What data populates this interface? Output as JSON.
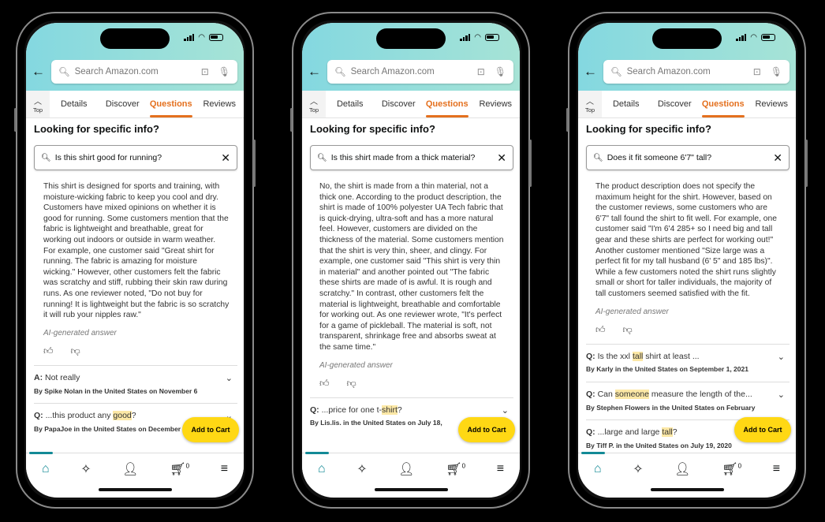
{
  "common": {
    "search_placeholder": "Search Amazon.com",
    "top_label": "Top",
    "tabs": [
      "Details",
      "Discover",
      "Questions",
      "Reviews"
    ],
    "active_tab": "Questions",
    "section_title": "Looking for specific info?",
    "ai_label": "AI-generated answer",
    "add_to_cart": "Add to Cart",
    "cart_count": "0",
    "accent": "#e4701e",
    "nav_icons": [
      "home-icon",
      "sparkle-icon",
      "profile-icon",
      "cart-icon",
      "menu-icon"
    ]
  },
  "phones": [
    {
      "query": "Is this shirt good for running?",
      "answer": "This shirt is designed for sports and training, with moisture-wicking fabric to keep you cool and dry. Customers have mixed opinions on whether it is good for running. Some customers mention that the fabric is lightweight and breathable, great for working out indoors or outside in warm weather. For example, one customer said \"Great shirt for running. The fabric is amazing for moisture wicking.\" However, other customers felt the fabric was scratchy and stiff, rubbing their skin raw during runs. As one reviewer noted, \"Do not buy for running! It is lightweight but the fabric is so scratchy it will rub your nipples raw.\"",
      "items": [
        {
          "label": "A:",
          "pre": " Not really",
          "hl": "",
          "post": "",
          "by": "By Spike Nolan in the United States on November 6"
        },
        {
          "label": "Q:",
          "pre": " ...this product any ",
          "hl": "good",
          "post": "?",
          "by": "By PapaJoe in the United States on December"
        }
      ]
    },
    {
      "query": "Is this shirt made from a thick material?",
      "answer": "No, the shirt is made from a thin material, not a thick one. According to the product description, the shirt is made of 100% polyester UA Tech fabric that is quick-drying, ultra-soft and has a more natural feel. However, customers are divided on the thickness of the material. Some customers mention that the shirt is very thin, sheer, and clingy. For example, one customer said \"This shirt is very thin in material\" and another pointed out \"The fabric these shirts are made of is awful. It is rough and scratchy.\" In contrast, other customers felt the material is lightweight, breathable and comfortable for working out. As one reviewer wrote, \"It's perfect for a game of pickleball. The material is soft, not transparent, shrinkage free and absorbs sweat at the same time.\"",
      "items": [
        {
          "label": "Q:",
          "pre": " ...price for one t-",
          "hl": "shirt",
          "post": "?",
          "by": "By Lis.lis. in the United States on July 18,"
        }
      ]
    },
    {
      "query": "Does it fit someone 6'7\" tall?",
      "answer": "The product description does not specify the maximum height for the shirt. However, based on the customer reviews, some customers who are 6'7\" tall found the shirt to fit well. For example, one customer said \"I'm 6'4 285+ so I need big and tall gear and these shirts are perfect for working out!\" Another customer mentioned \"Size large was a perfect fit for my tall husband (6' 5\" and 185 lbs)\". While a few customers noted the shirt runs slightly small or short for taller individuals, the majority of tall customers seemed satisfied with the fit.",
      "items": [
        {
          "label": "Q:",
          "pre": " Is the xxl ",
          "hl": "tall",
          "post": " shirt at least ...",
          "by": "By Karly in the United States on September 1, 2021"
        },
        {
          "label": "Q:",
          "pre": " Can ",
          "hl": "someone",
          "post": " measure the length of the...",
          "by": "By Stephen Flowers in the United States on February"
        },
        {
          "label": "Q:",
          "pre": " ...large and large ",
          "hl": "tall",
          "post": "?",
          "by": "By Tiff P. in the United States on July 19, 2020"
        }
      ]
    }
  ]
}
